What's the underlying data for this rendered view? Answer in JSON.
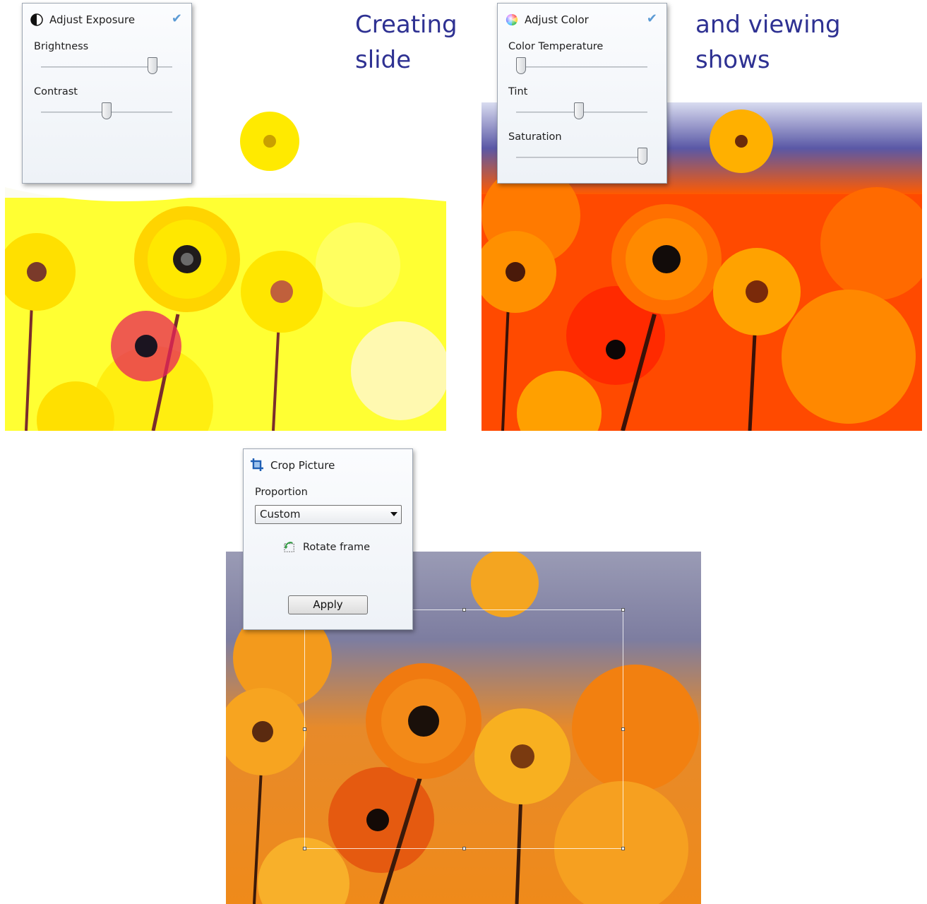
{
  "headlines": {
    "left": [
      "Creating",
      "slide"
    ],
    "right": [
      "and viewing",
      "shows"
    ]
  },
  "exposure_panel": {
    "title": "Adjust Exposure",
    "icon": "half-circle-contrast-icon",
    "confirm_icon": "checkmark-icon",
    "brightness": {
      "label": "Brightness",
      "value": 0.85
    },
    "contrast": {
      "label": "Contrast",
      "value": 0.5
    }
  },
  "color_panel": {
    "title": "Adjust Color",
    "icon": "color-wheel-icon",
    "confirm_icon": "checkmark-icon",
    "temperature": {
      "label": "Color Temperature",
      "value": 0.04
    },
    "tint": {
      "label": "Tint",
      "value": 0.48
    },
    "saturation": {
      "label": "Saturation",
      "value": 0.96
    }
  },
  "crop_panel": {
    "title": "Crop Picture",
    "icon": "crop-icon",
    "proportion_label": "Proportion",
    "proportion_value": "Custom",
    "rotate_label": "Rotate frame",
    "rotate_icon": "rotate-frame-icon",
    "apply_label": "Apply"
  },
  "colors": {
    "headline": "#2e3192",
    "check": "#5b9bd5"
  }
}
